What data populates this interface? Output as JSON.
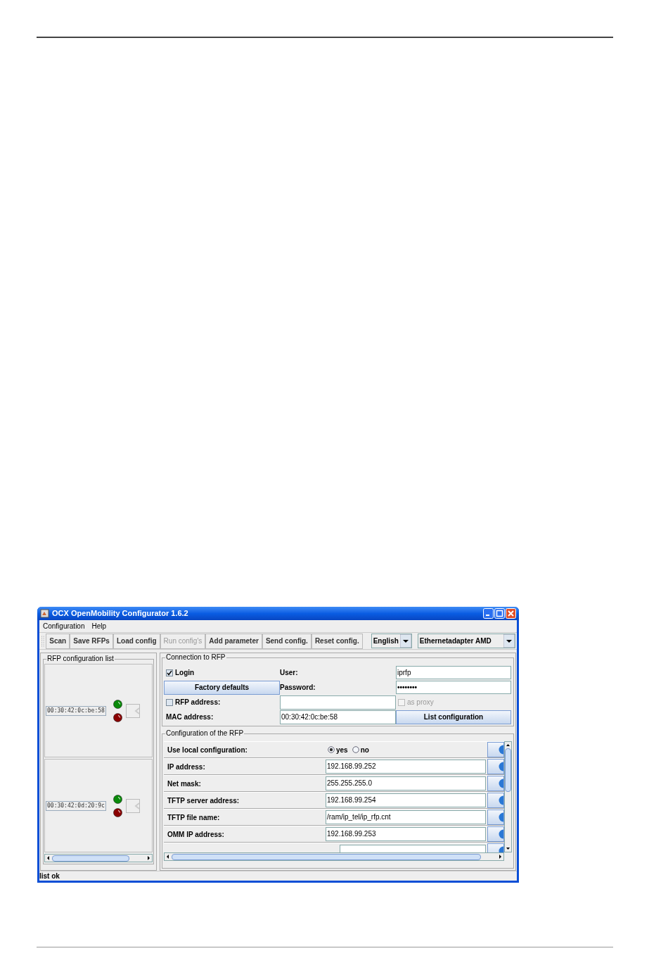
{
  "window": {
    "title": "OCX OpenMobility Configurator 1.6.2"
  },
  "menu": [
    "Configuration",
    "Help"
  ],
  "toolbar": {
    "buttons": [
      {
        "label": "Scan",
        "disabled": false
      },
      {
        "label": "Save RFPs",
        "disabled": false
      },
      {
        "label": "Load config",
        "disabled": false
      },
      {
        "label": "Run config's",
        "disabled": true
      },
      {
        "label": "Add parameter",
        "disabled": false
      },
      {
        "label": "Send config.",
        "disabled": false
      },
      {
        "label": "Reset config.",
        "disabled": false
      }
    ],
    "dropdowns": [
      {
        "value": "English"
      },
      {
        "value": "Ethernetadapter AMD"
      }
    ]
  },
  "rfp_list": {
    "title": "RFP configuration list",
    "items": [
      {
        "mac": "00:30:42:0c:be:58"
      },
      {
        "mac": "00:30:42:0d:20:9c"
      }
    ]
  },
  "connection": {
    "title": "Connection to RFP",
    "login": {
      "label": "Login",
      "checked": true
    },
    "user_label": "User:",
    "user_value": "iprfp",
    "factory_button": "Factory defaults",
    "password_label": "Password:",
    "password_value": "••••••••",
    "rfp_address": {
      "label": "RFP address:",
      "checked": false
    },
    "as_proxy": {
      "label": "as proxy",
      "checked": false,
      "disabled": true
    },
    "mac_label": "MAC address:",
    "mac_value": "00:30:42:0c:be:58",
    "list_button": "List configuration"
  },
  "config": {
    "title": "Configuration of the RFP",
    "rows": [
      {
        "kind": "radio",
        "label": "Use local configuration:",
        "options": [
          {
            "label": "yes",
            "selected": true
          },
          {
            "label": "no",
            "selected": false
          }
        ]
      },
      {
        "kind": "text",
        "label": "IP address:",
        "value": "192.168.99.252"
      },
      {
        "kind": "text",
        "label": "Net mask:",
        "value": "255.255.255.0"
      },
      {
        "kind": "text",
        "label": "TFTP server address:",
        "value": "192.168.99.254"
      },
      {
        "kind": "text",
        "label": "TFTP file name:",
        "value": "/ram/ip_tel/ip_rfp.cnt"
      },
      {
        "kind": "text",
        "label": "OMM IP address:",
        "value": "192.168.99.253"
      },
      {
        "kind": "partial"
      }
    ]
  },
  "status_bar": "list ok"
}
